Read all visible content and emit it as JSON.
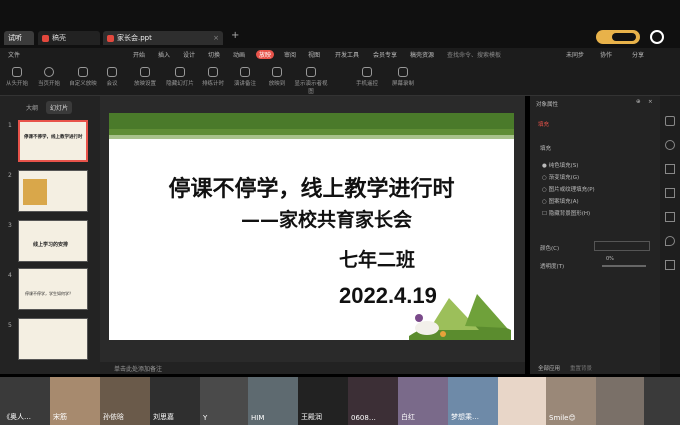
{
  "tabs": {
    "home": "试听",
    "draft": "稿壳",
    "file": "家长会.ppt"
  },
  "menubar": [
    "文件",
    "开始",
    "插入",
    "设计",
    "切换",
    "动画",
    "放映",
    "审阅",
    "视图",
    "开发工具",
    "会员专享",
    "稿壳资源"
  ],
  "menu_active": "放映",
  "search_placeholder": "查找命令、搜索模板",
  "header_actions": [
    "未同步",
    "协作",
    "分享"
  ],
  "toolbar": [
    "从头开始",
    "当页开始",
    "自定义放映",
    "会议",
    "放映设置",
    "隐藏幻灯片",
    "排练计时",
    "演讲备注",
    "放映到",
    "显示演示者视图",
    "手机遥控",
    "屏幕录制"
  ],
  "leftpanel_tabs": [
    "大纲",
    "幻灯片"
  ],
  "thumbs": [
    {
      "num": "1",
      "text": "停课不停学，线上教学进行时"
    },
    {
      "num": "2",
      "text": ""
    },
    {
      "num": "3",
      "text": "线上学习的安排"
    },
    {
      "num": "4",
      "text": "停课不停学，学生如何学？"
    },
    {
      "num": "5",
      "text": ""
    }
  ],
  "slide": {
    "title": "停课不停学，线上教学进行时",
    "subtitle": "——家校共育家长会",
    "class": "七年二班",
    "date": "2022.4.19"
  },
  "rightpanel": {
    "header": "对象属性",
    "tab": "填充",
    "section": "填充",
    "options": [
      "纯色填充(S)",
      "渐变填充(G)",
      "图片或纹理填充(P)",
      "图案填充(A)",
      "隐藏背景图形(H)"
    ],
    "color_label": "颜色(C)",
    "transparency_label": "透明度(T)",
    "transparency_value": "0%",
    "apply_all": "全部应用",
    "reset": "重置背景"
  },
  "notes": "单击此处添加备注",
  "participants": [
    "《奥人…",
    "宋筋",
    "孙依晗",
    "刘思嘉",
    "Y",
    "HIM",
    "王殿润",
    "0608…",
    "白红",
    "梦想乘…",
    "",
    "Smile😊",
    "",
    ""
  ],
  "colors": {
    "accent": "#c0392b",
    "menu_active": "#e8534a",
    "slide_green": "#4a7a2a"
  }
}
